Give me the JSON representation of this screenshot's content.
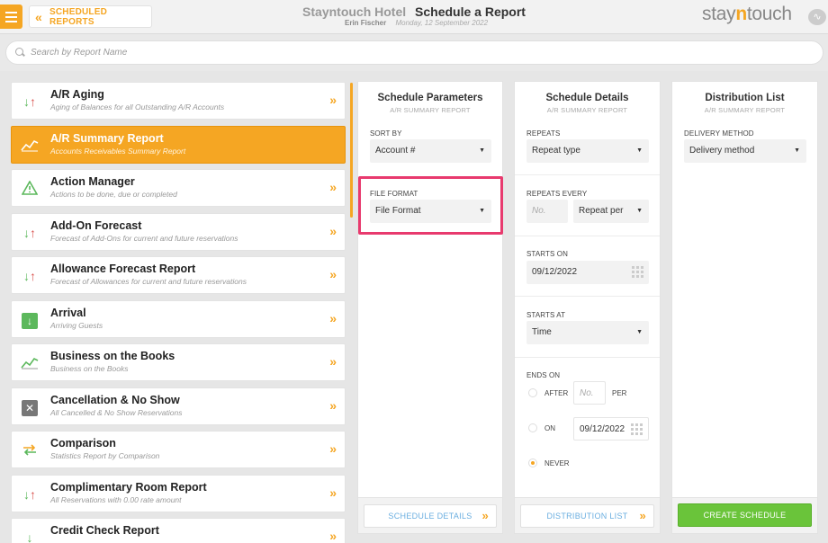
{
  "header": {
    "back_label": "SCHEDULED REPORTS",
    "hotel": "Stayntouch Hotel",
    "page_title": "Schedule a Report",
    "user": "Erin Fischer",
    "date": "Monday, 12 September 2022",
    "logo_prefix": "stay",
    "logo_n": "n",
    "logo_suffix": "touch"
  },
  "search": {
    "placeholder": "Search by Report Name"
  },
  "reports": [
    {
      "name": "A/R Aging",
      "desc": "Aging of Balances for all Outstanding A/R Accounts",
      "icon": "arrows-down-up-icon"
    },
    {
      "name": "A/R Summary Report",
      "desc": "Accounts Receivables Summary Report",
      "icon": "trend-chart-icon",
      "active": true
    },
    {
      "name": "Action Manager",
      "desc": "Actions to be done, due or completed",
      "icon": "warning-icon"
    },
    {
      "name": "Add-On Forecast",
      "desc": "Forecast of Add-Ons for current and future reservations",
      "icon": "arrows-down-up-icon"
    },
    {
      "name": "Allowance Forecast Report",
      "desc": "Forecast of Allowances for current and future reservations",
      "icon": "arrows-down-up-icon"
    },
    {
      "name": "Arrival",
      "desc": "Arriving Guests",
      "icon": "arrival-icon"
    },
    {
      "name": "Business on the Books",
      "desc": "Business on the Books",
      "icon": "trend-chart-icon"
    },
    {
      "name": "Cancellation & No Show",
      "desc": "All Cancelled & No Show Reservations",
      "icon": "cancel-icon"
    },
    {
      "name": "Comparison",
      "desc": "Statistics Report by Comparison",
      "icon": "compare-icon"
    },
    {
      "name": "Complimentary Room Report",
      "desc": "All Reservations with 0.00 rate amount",
      "icon": "arrows-down-up-icon"
    },
    {
      "name": "Credit Check Report",
      "desc": "",
      "icon": "credit-check-icon"
    }
  ],
  "params": {
    "title": "Schedule Parameters",
    "subtitle": "A/R SUMMARY REPORT",
    "sort_label": "SORT BY",
    "sort_value": "Account #",
    "format_label": "FILE FORMAT",
    "format_value": "File Format",
    "next": "SCHEDULE DETAILS"
  },
  "details": {
    "title": "Schedule Details",
    "subtitle": "A/R SUMMARY REPORT",
    "repeats_label": "REPEATS",
    "repeats_value": "Repeat type",
    "every_label": "REPEATS EVERY",
    "every_placeholder": "No.",
    "every_per": "Repeat per",
    "starts_on_label": "STARTS ON",
    "starts_on_value": "09/12/2022",
    "starts_at_label": "STARTS AT",
    "starts_at_value": "Time",
    "ends_on_label": "ENDS ON",
    "after_label": "AFTER",
    "after_placeholder": "No.",
    "per_label": "PER",
    "on_label": "ON",
    "on_value": "09/12/2022",
    "never_label": "NEVER",
    "selected_end": "never",
    "next": "DISTRIBUTION LIST"
  },
  "distribution": {
    "title": "Distribution List",
    "subtitle": "A/R SUMMARY REPORT",
    "method_label": "DELIVERY METHOD",
    "method_value": "Delivery method",
    "create": "CREATE SCHEDULE"
  },
  "colors": {
    "accent": "#f5a623",
    "highlight": "#e83a6e",
    "create": "#6ac43a",
    "link": "#6aaee0"
  }
}
